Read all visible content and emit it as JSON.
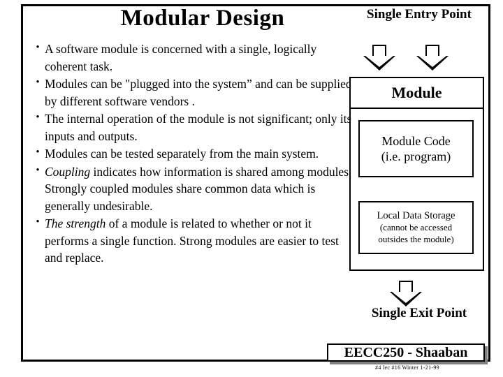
{
  "slide": {
    "title": "Modular Design",
    "bullets": [
      {
        "marker": "•",
        "segments": [
          {
            "text": "A software module is concerned with a single, logically coherent task.",
            "style": "normal"
          }
        ]
      },
      {
        "marker": "•",
        "segments": [
          {
            "text": "Modules can be \"plugged into the system” and can be supplied by different software vendors .",
            "style": "normal"
          }
        ]
      },
      {
        "marker": "•",
        "segments": [
          {
            "text": "The internal operation of the module is not significant; only its inputs and outputs.",
            "style": "normal"
          }
        ]
      },
      {
        "marker": "•",
        "segments": [
          {
            "text": "Modules can be tested separately from the main system.",
            "style": "normal"
          }
        ]
      },
      {
        "marker": "•",
        "segments": [
          {
            "text": "Coupling",
            "style": "italic"
          },
          {
            "text": " indicates how information is shared among modules.  Strongly coupled modules share common data which is generally undesirable.",
            "style": "normal"
          }
        ]
      },
      {
        "marker": "•",
        "segments": [
          {
            "text": "The strength",
            "style": "italic"
          },
          {
            "text": " of a module is related to whether or not it performs a single function.   Strong modules are easier to test and replace.",
            "style": "normal"
          }
        ]
      }
    ],
    "diagram": {
      "entry_label": "Single Entry Point",
      "module_label": "Module",
      "code_line1": "Module Code",
      "code_line2": "(i.e. program)",
      "storage_title": "Local Data Storage",
      "storage_sub1": "(cannot be accessed",
      "storage_sub2": "outsides the module)",
      "exit_label": "Single Exit Point"
    },
    "footer": {
      "course": "EECC250 - Shaaban",
      "note": "#4 lec #16  Winter 1-21-99"
    }
  }
}
